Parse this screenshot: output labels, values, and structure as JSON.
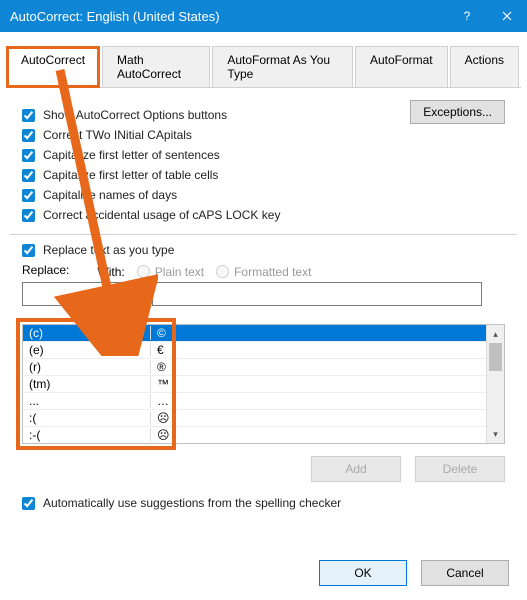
{
  "title": "AutoCorrect: English (United States)",
  "tabs": [
    "AutoCorrect",
    "Math AutoCorrect",
    "AutoFormat As You Type",
    "AutoFormat",
    "Actions"
  ],
  "checks": {
    "show_options": "Show AutoCorrect Options buttons",
    "two_initial": "Correct TWo INitial CApitals",
    "first_sentence": "Capitalize first letter of sentences",
    "first_cell": "Capitalize first letter of table cells",
    "days": "Capitalize names of days",
    "caps_lock": "Correct accidental usage of cAPS LOCK key",
    "replace_as_type": "Replace text as you type",
    "auto_suggest": "Automatically use suggestions from the spelling checker"
  },
  "exceptions_btn": "Exceptions...",
  "replace_label": "Replace:",
  "with_label": "With:",
  "radio_plain": "Plain text",
  "radio_formatted": "Formatted text",
  "replace_input": "",
  "with_input": "",
  "list": [
    {
      "from": "(c)",
      "to": "©"
    },
    {
      "from": "(e)",
      "to": "€"
    },
    {
      "from": "(r)",
      "to": "®"
    },
    {
      "from": "(tm)",
      "to": "™"
    },
    {
      "from": "...",
      "to": "…"
    },
    {
      "from": ":(",
      "to": "☹"
    },
    {
      "from": ":-(",
      "to": "☹"
    }
  ],
  "btn_add": "Add",
  "btn_delete": "Delete",
  "btn_ok": "OK",
  "btn_cancel": "Cancel"
}
